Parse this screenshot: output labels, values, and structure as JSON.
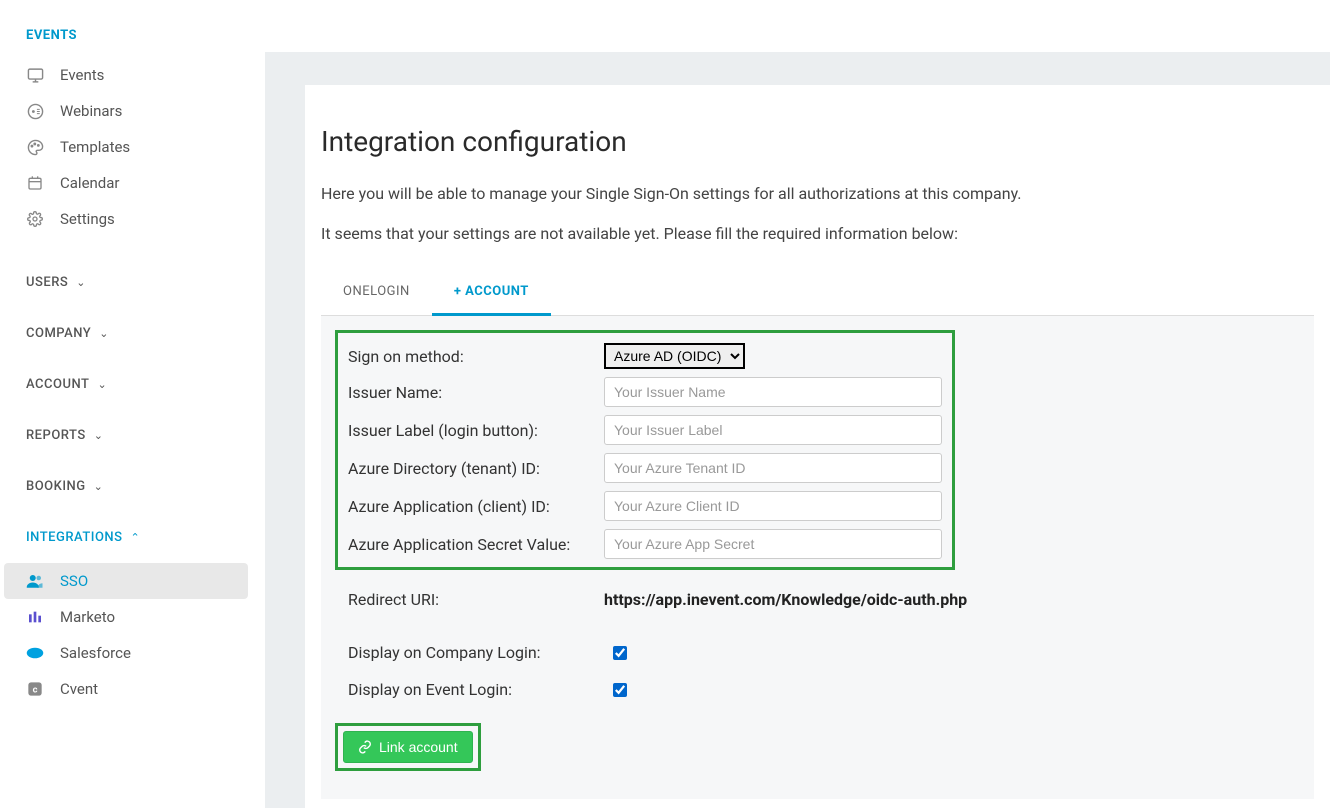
{
  "sidebar": {
    "section_title": "EVENTS",
    "items": [
      {
        "label": "Events",
        "icon": "monitor-icon"
      },
      {
        "label": "Webinars",
        "icon": "webinar-icon"
      },
      {
        "label": "Templates",
        "icon": "palette-icon"
      },
      {
        "label": "Calendar",
        "icon": "calendar-icon"
      },
      {
        "label": "Settings",
        "icon": "gear-icon"
      }
    ],
    "collapsibles": [
      {
        "label": "USERS",
        "expanded": false
      },
      {
        "label": "COMPANY",
        "expanded": false
      },
      {
        "label": "ACCOUNT",
        "expanded": false
      },
      {
        "label": "REPORTS",
        "expanded": false
      },
      {
        "label": "BOOKING",
        "expanded": false
      },
      {
        "label": "INTEGRATIONS",
        "expanded": true
      }
    ],
    "integrations": [
      {
        "label": "SSO",
        "icon": "users-icon",
        "active": true
      },
      {
        "label": "Marketo",
        "icon": "marketo-icon",
        "active": false
      },
      {
        "label": "Salesforce",
        "icon": "salesforce-icon",
        "active": false
      },
      {
        "label": "Cvent",
        "icon": "cvent-icon",
        "active": false
      }
    ]
  },
  "main": {
    "title": "Integration configuration",
    "desc1": "Here you will be able to manage your Single Sign-On settings for all authorizations at this company.",
    "desc2": "It seems that your settings are not available yet. Please fill the required information below:",
    "tabs": [
      {
        "label": "ONELOGIN",
        "active": false
      },
      {
        "label": "+ ACCOUNT",
        "active": true
      }
    ],
    "form": {
      "sign_on_method_label": "Sign on method:",
      "sign_on_method_value": "Azure AD (OIDC)",
      "issuer_name_label": "Issuer Name:",
      "issuer_name_placeholder": "Your Issuer Name",
      "issuer_label_label": "Issuer Label (login button):",
      "issuer_label_placeholder": "Your Issuer Label",
      "tenant_id_label": "Azure Directory (tenant) ID:",
      "tenant_id_placeholder": "Your Azure Tenant ID",
      "client_id_label": "Azure Application (client) ID:",
      "client_id_placeholder": "Your Azure Client ID",
      "secret_label": "Azure Application Secret Value:",
      "secret_placeholder": "Your Azure App Secret",
      "redirect_uri_label": "Redirect URI:",
      "redirect_uri_value": "https://app.inevent.com/Knowledge/oidc-auth.php",
      "display_company_label": "Display on Company Login:",
      "display_company_checked": true,
      "display_event_label": "Display on Event Login:",
      "display_event_checked": true,
      "link_button_label": "Link account"
    }
  }
}
